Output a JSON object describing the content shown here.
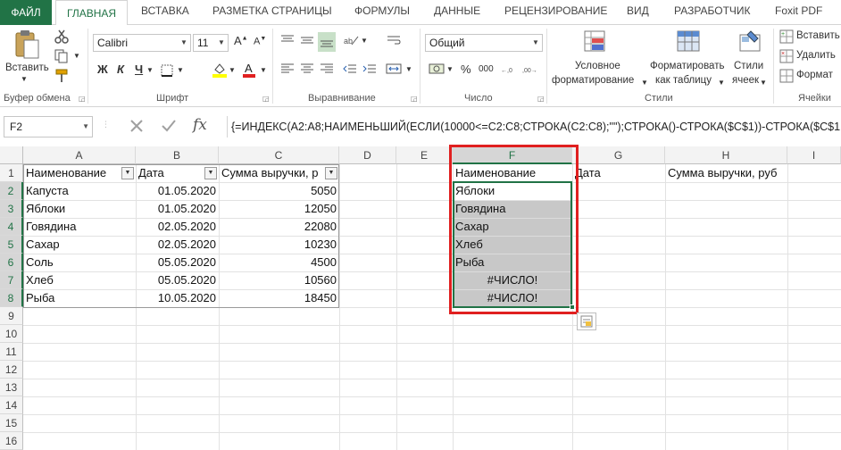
{
  "tabs": [
    "ФАЙЛ",
    "ГЛАВНАЯ",
    "ВСТАВКА",
    "РАЗМЕТКА СТРАНИЦЫ",
    "ФОРМУЛЫ",
    "ДАННЫЕ",
    "РЕЦЕНЗИРОВАНИЕ",
    "ВИД",
    "РАЗРАБОТЧИК",
    "Foxit PDF"
  ],
  "ribbon": {
    "paste_label": "Вставить",
    "clipboard_label": "Буфер обмена",
    "font_name": "Calibri",
    "font_size": "11",
    "bold": "Ж",
    "italic": "К",
    "underline": "Ч",
    "font_label": "Шрифт",
    "alignment_label": "Выравнивание",
    "number_format": "Общий",
    "number_label": "Число",
    "cond_format_1": "Условное",
    "cond_format_2": "форматирование",
    "format_table_1": "Форматировать",
    "format_table_2": "как таблицу",
    "cell_styles_1": "Стили",
    "cell_styles_2": "ячеек",
    "styles_label": "Стили",
    "insert_cells": "Вставить",
    "delete_cells": "Удалить",
    "format_cells": "Формат",
    "cells_label": "Ячейки",
    "percent": "%",
    "thousands": "000"
  },
  "formula_bar": {
    "name_box": "F2",
    "fx": "fx",
    "formula": "{=ИНДЕКС(A2:A8;НАИМЕНЬШИЙ(ЕСЛИ(10000<=C2:C8;СТРОКА(C2:C8);\"\");СТРОКА()-СТРОКА($C$1))-СТРОКА($C$1"
  },
  "columns": [
    "A",
    "B",
    "C",
    "D",
    "E",
    "F",
    "G",
    "H",
    "I"
  ],
  "rows": [
    "1",
    "2",
    "3",
    "4",
    "5",
    "6",
    "7",
    "8",
    "9",
    "10",
    "11",
    "12",
    "13",
    "14",
    "15",
    "16"
  ],
  "sheet": {
    "headers": {
      "a": "Наименование",
      "b": "Дата",
      "c": "Сумма выручки, р",
      "f": "Наименование",
      "g": "Дата",
      "h": "Сумма выручки, руб"
    },
    "table": [
      {
        "name": "Капуста",
        "date": "01.05.2020",
        "sum": "5050"
      },
      {
        "name": "Яблоки",
        "date": "01.05.2020",
        "sum": "12050"
      },
      {
        "name": "Говядина",
        "date": "02.05.2020",
        "sum": "22080"
      },
      {
        "name": "Сахар",
        "date": "02.05.2020",
        "sum": "10230"
      },
      {
        "name": "Соль",
        "date": "05.05.2020",
        "sum": "4500"
      },
      {
        "name": "Хлеб",
        "date": "05.05.2020",
        "sum": "10560"
      },
      {
        "name": "Рыба",
        "date": "10.05.2020",
        "sum": "18450"
      }
    ],
    "result": [
      "Яблоки",
      "Говядина",
      "Сахар",
      "Хлеб",
      "Рыба",
      "#ЧИСЛО!",
      "#ЧИСЛО!"
    ]
  },
  "colors": {
    "accent": "#217346",
    "highlight": "#e02020",
    "selection_fill": "#c8c8c8"
  }
}
